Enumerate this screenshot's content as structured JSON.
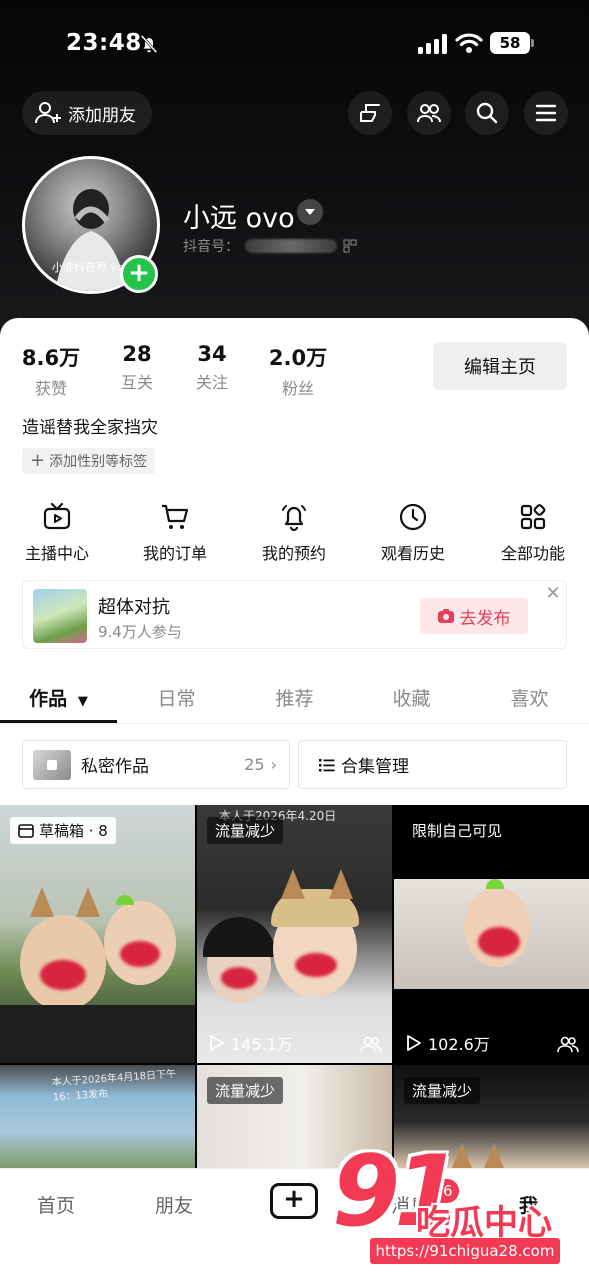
{
  "status_bar": {
    "time": "23:48",
    "battery": "58"
  },
  "header": {
    "add_friend_label": "添加朋友",
    "avatar_text": "小准抖音号 yov",
    "nickname": "小远 ovo",
    "douyin_id_label": "抖音号："
  },
  "stats": [
    {
      "value": "8.6万",
      "label": "获赞"
    },
    {
      "value": "28",
      "label": "互关"
    },
    {
      "value": "34",
      "label": "关注"
    },
    {
      "value": "2.0万",
      "label": "粉丝"
    }
  ],
  "edit_profile_label": "编辑主页",
  "bio": "造谣替我全家挡灾",
  "tag_chip_label": "添加性别等标签",
  "functions": [
    {
      "label": "主播中心",
      "icon": "tv-icon"
    },
    {
      "label": "我的订单",
      "icon": "cart-icon"
    },
    {
      "label": "我的预约",
      "icon": "bell-icon"
    },
    {
      "label": "观看历史",
      "icon": "clock-icon"
    },
    {
      "label": "全部功能",
      "icon": "grid-icon"
    }
  ],
  "promo": {
    "title": "超体对抗",
    "subtitle": "9.4万人参与",
    "button_label": "去发布"
  },
  "tabs": [
    {
      "label": "作品",
      "active": true
    },
    {
      "label": "日常"
    },
    {
      "label": "推荐"
    },
    {
      "label": "收藏"
    },
    {
      "label": "喜欢"
    }
  ],
  "private_works": {
    "label": "私密作品",
    "count": "25"
  },
  "collection_mgmt_label": "合集管理",
  "grid": [
    {
      "label": "草稿箱 · 8"
    },
    {
      "label": "流量减少",
      "overlay": "本人于2026年4.20日",
      "plays": "145.1万"
    },
    {
      "label": "限制自己可见",
      "plays": "102.6万"
    },
    {
      "overlay": "本人于2026年4月18日下午16：13发布"
    },
    {
      "label": "流量减少"
    },
    {
      "label": "流量减少"
    }
  ],
  "bottom_nav": {
    "home": "首页",
    "friends": "朋友",
    "messages": "消息",
    "me": "我",
    "badge": "26"
  },
  "watermark": {
    "logo": "91",
    "text": "吃瓜中心",
    "url": "https://91chigua28.com"
  }
}
